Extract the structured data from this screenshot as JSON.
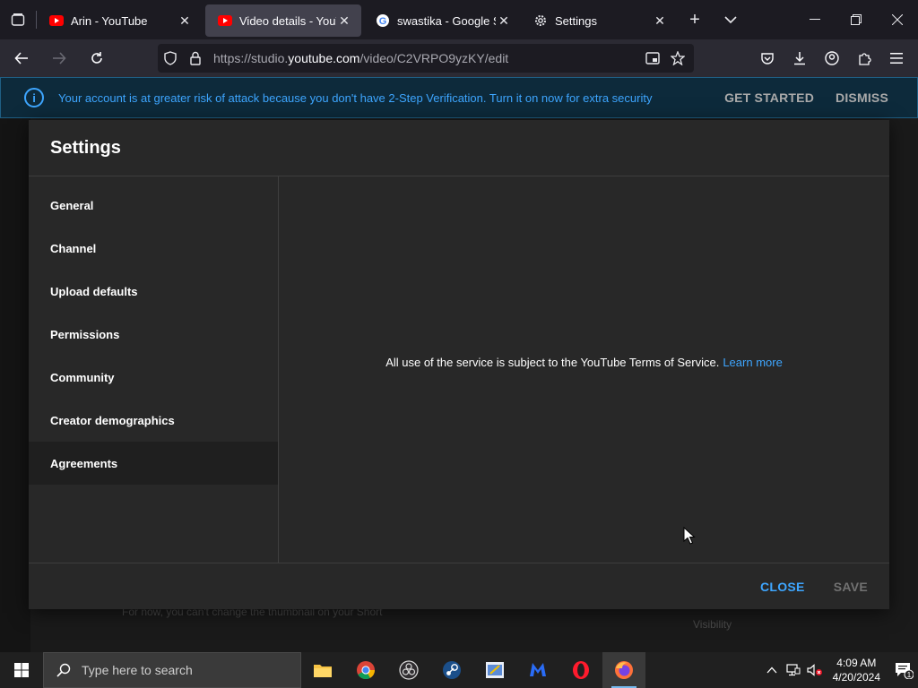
{
  "browser": {
    "tabs": [
      {
        "title": "Arin - YouTube",
        "icon": "youtube-icon",
        "active": false
      },
      {
        "title": "Video details - YouTube",
        "icon": "youtube-icon",
        "active": true
      },
      {
        "title": "swastika - Google Search",
        "icon": "google-icon",
        "active": false
      },
      {
        "title": "Settings",
        "icon": "gear-icon",
        "active": false
      }
    ],
    "url_prefix": "https://studio.",
    "url_domain": "youtube.com",
    "url_path": "/video/C2VRPO9yzKY/edit"
  },
  "banner": {
    "text": "Your account is at greater risk of attack because you don't have 2-Step Verification. Turn it on now for extra security",
    "get_started": "GET STARTED",
    "dismiss": "DISMISS"
  },
  "background": {
    "thumbnail_note": "For now, you can't change the thumbnail on your Short",
    "visibility_label": "Visibility"
  },
  "modal": {
    "title": "Settings",
    "sidebar": [
      {
        "label": "General"
      },
      {
        "label": "Channel"
      },
      {
        "label": "Upload defaults"
      },
      {
        "label": "Permissions"
      },
      {
        "label": "Community"
      },
      {
        "label": "Creator demographics"
      },
      {
        "label": "Agreements"
      }
    ],
    "selected_item": "Agreements",
    "content_text": "All use of the service is subject to the YouTube Terms of Service.",
    "content_link": "Learn more",
    "close_label": "CLOSE",
    "save_label": "SAVE"
  },
  "taskbar": {
    "search_placeholder": "Type here to search",
    "time": "4:09 AM",
    "date": "4/20/2024",
    "notification_count": "1",
    "apps": [
      "file-explorer-icon",
      "chrome-icon",
      "obs-icon",
      "steam-icon",
      "paint-icon",
      "malwarebytes-icon",
      "opera-icon",
      "firefox-icon"
    ]
  },
  "colors": {
    "accent_blue": "#3ea6ff",
    "youtube_red": "#ff0000",
    "modal_bg": "#282828"
  }
}
